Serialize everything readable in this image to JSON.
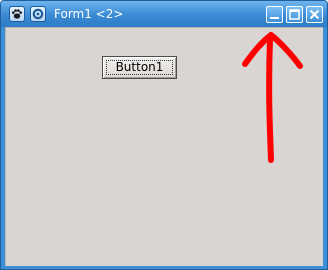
{
  "window": {
    "title": "Form1 <2>",
    "titlebar_icons": [
      "paw-icon",
      "gear-icon"
    ],
    "controls": [
      "minimize-icon",
      "maximize-icon",
      "close-icon"
    ]
  },
  "form": {
    "button_label": "Button1"
  },
  "annotation": {
    "type": "arrow",
    "color": "#ff0000",
    "points_to": "minimize-button"
  },
  "colors": {
    "titlebar": "#3a8ad4",
    "client_background": "#d9d5d2"
  }
}
